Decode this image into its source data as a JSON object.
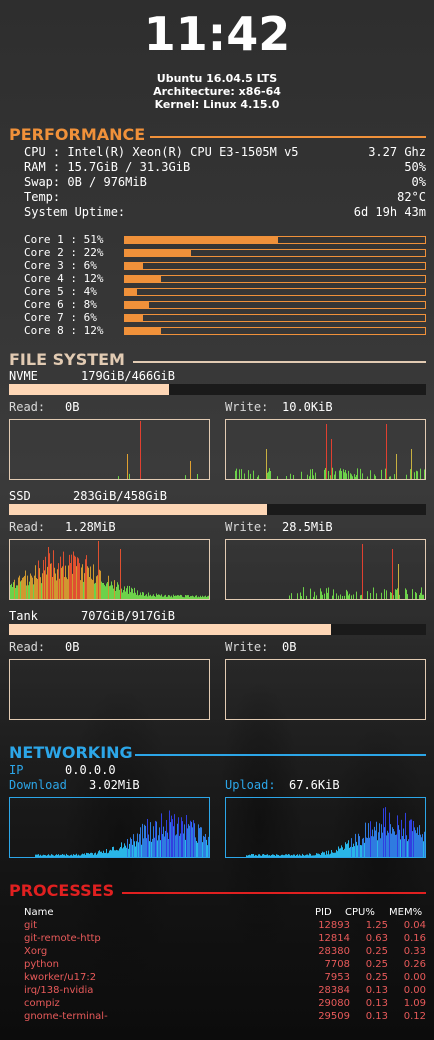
{
  "clock": "11:42",
  "system": {
    "os": "Ubuntu 16.04.5 LTS",
    "arch": "Architecture: x86-64",
    "kernel": "Kernel: Linux 4.15.0"
  },
  "colors": {
    "performance": "#f0913a",
    "filesystem": "#e2cbb3",
    "networking": "#2ca6e8",
    "processes": "#e02020"
  },
  "performance": {
    "title": "PERFORMANCE",
    "cpu_label": "CPU : Intel(R) Xeon(R) CPU E3-1505M v5",
    "cpu_value": "3.27 Ghz",
    "ram_label": "RAM : 15.7GiB / 31.3GiB",
    "ram_value": "50%",
    "swap_label": "Swap: 0B / 976MiB",
    "swap_value": "0%",
    "temp_label": "Temp:",
    "temp_value": "82°C",
    "uptime_label": "System Uptime:",
    "uptime_value": "6d 19h 43m",
    "cores": [
      {
        "label": "Core 1 : 51%",
        "percent": 51
      },
      {
        "label": "Core 2 : 22%",
        "percent": 22
      },
      {
        "label": "Core 3 : 6%",
        "percent": 6
      },
      {
        "label": "Core 4 : 12%",
        "percent": 12
      },
      {
        "label": "Core 5 : 4%",
        "percent": 4
      },
      {
        "label": "Core 6 : 8%",
        "percent": 8
      },
      {
        "label": "Core 7 : 6%",
        "percent": 6
      },
      {
        "label": "Core 8 : 12%",
        "percent": 12
      }
    ]
  },
  "filesystem": {
    "title": "FILE SYSTEM",
    "read_label": "Read:",
    "write_label": "Write:",
    "drives": [
      {
        "name": "NVME",
        "usage": "179GiB/466GiB",
        "fraction": 0.384,
        "read": "0B",
        "write": "10.0KiB"
      },
      {
        "name": "SSD",
        "usage": "283GiB/458GiB",
        "fraction": 0.618,
        "read": "1.28MiB",
        "write": "28.5MiB"
      },
      {
        "name": "Tank",
        "usage": "707GiB/917GiB",
        "fraction": 0.771,
        "read": "0B",
        "write": "0B"
      }
    ]
  },
  "networking": {
    "title": "NETWORKING",
    "ip_label": "IP",
    "ip_value": "0.0.0.0",
    "download_label": "Download",
    "download_value": "3.02MiB",
    "upload_label": "Upload:",
    "upload_value": "67.6KiB"
  },
  "processes": {
    "title": "PROCESSES",
    "headers": {
      "name": "Name",
      "pid": "PID",
      "cpu": "CPU%",
      "mem": "MEM%"
    },
    "rows": [
      {
        "name": "git",
        "pid": "12893",
        "cpu": "1.25",
        "mem": "0.04"
      },
      {
        "name": "git-remote-http",
        "pid": "12814",
        "cpu": "0.63",
        "mem": "0.16"
      },
      {
        "name": "Xorg",
        "pid": "28380",
        "cpu": "0.25",
        "mem": "0.33"
      },
      {
        "name": "python",
        "pid": "7708",
        "cpu": "0.25",
        "mem": "0.26"
      },
      {
        "name": "kworker/u17:2",
        "pid": "7953",
        "cpu": "0.25",
        "mem": "0.00"
      },
      {
        "name": "irq/138-nvidia",
        "pid": "28384",
        "cpu": "0.13",
        "mem": "0.00"
      },
      {
        "name": "compiz",
        "pid": "29080",
        "cpu": "0.13",
        "mem": "1.09"
      },
      {
        "name": "gnome-terminal-",
        "pid": "29509",
        "cpu": "0.13",
        "mem": "0.12"
      }
    ]
  }
}
